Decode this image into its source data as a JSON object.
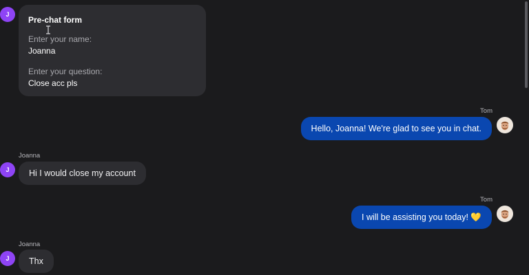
{
  "visitor": {
    "initial": "J",
    "name": "Joanna"
  },
  "agent": {
    "name": "Tom"
  },
  "prechat_form": {
    "title": "Pre-chat form",
    "name_label": "Enter your name:",
    "name_value": "Joanna",
    "question_label": "Enter your question:",
    "question_value": "Close acc pls"
  },
  "messages": [
    {
      "from": "agent",
      "sender": "Tom",
      "text": "Hello, Joanna! We're glad to see you in chat."
    },
    {
      "from": "visitor",
      "sender": "Joanna",
      "text": "Hi I would close my account"
    },
    {
      "from": "agent",
      "sender": "Tom",
      "text": "I will be assisting you today! 💛"
    },
    {
      "from": "visitor",
      "sender": "Joanna",
      "text": "Thx"
    }
  ],
  "colors": {
    "background": "#1b1b1d",
    "visitor_bubble": "#2d2d31",
    "agent_bubble": "#0a47b0",
    "visitor_avatar": "#8e44f5"
  }
}
